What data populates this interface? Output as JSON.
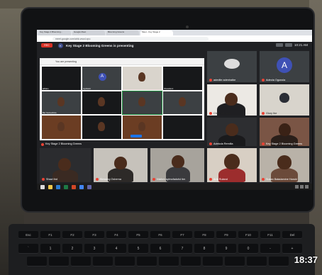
{
  "browser": {
    "tabs": [
      "Key Stage 2 Blooming...",
      "Google Meet",
      "Blooming Greens",
      "Meet - Key Stage 2"
    ],
    "url": "meet.google.com/ahk-vwcd-xpu"
  },
  "meet": {
    "rec_label": "REC",
    "presenter_initial": "K",
    "presenting_text": "Key Stage 2 Blooming Greens is presenting",
    "clock": "10:21 AM"
  },
  "presented": {
    "title": "You are presenting",
    "tile_labels": [
      "adbatu",
      "Ayobami",
      "",
      "Oluwafemi",
      "Bar Gameshina",
      "",
      "",
      "",
      "",
      "",
      "",
      ""
    ],
    "avatar_letter": "A"
  },
  "right_tiles": [
    {
      "label": "adedite adeniraibe",
      "avatar": ""
    },
    {
      "label": "Adeola Ogunola",
      "avatar": "A"
    },
    {
      "label": "Chinelo Nubia",
      "avatar": ""
    },
    {
      "label": "Glory Ibe",
      "avatar": ""
    },
    {
      "label": "Adekola Remilla",
      "avatar": ""
    },
    {
      "label": "Key Stage 2 Blooming Greens",
      "avatar": ""
    }
  ],
  "left_row_label": "Key Stage 2 Blooming Greens",
  "bottom_tiles": [
    {
      "label": "Shazi Ibd"
    },
    {
      "label": "Blessing Osherna"
    },
    {
      "label": "Nizibm ayimofaduful tim"
    },
    {
      "label": "Aria Ruland"
    },
    {
      "label": "Susan Baladamine Haruki"
    }
  ],
  "keyboard": {
    "fn_row": [
      "Esc",
      "F1",
      "F2",
      "F3",
      "F4",
      "F5",
      "F6",
      "F7",
      "F8",
      "F9",
      "F10",
      "F11",
      "Del"
    ],
    "num_row": [
      "`",
      "1",
      "2",
      "3",
      "4",
      "5",
      "6",
      "7",
      "8",
      "9",
      "0",
      "-",
      "+"
    ]
  },
  "overlay_time": "18:37"
}
